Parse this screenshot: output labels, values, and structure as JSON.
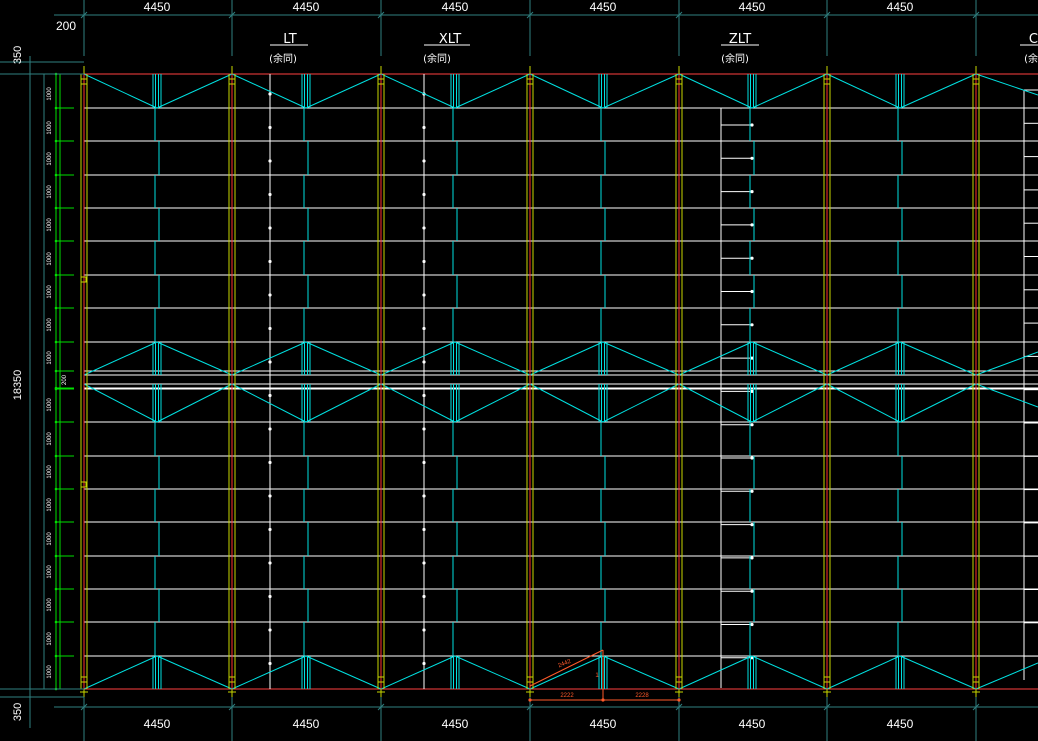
{
  "drawing": {
    "top_dims": [
      "4450",
      "4450",
      "4450",
      "4450",
      "4450",
      "4450"
    ],
    "bottom_dims": [
      "4450",
      "4450",
      "4450",
      "4450",
      "4450",
      "4450"
    ],
    "top_small_dim": "200",
    "left_top_dim": "350",
    "left_bottom_dim": "350",
    "left_total_dim": "18350",
    "left_mid_dim": "200",
    "row_dims_upper": [
      "1000",
      "1000",
      "1000",
      "1000",
      "1000",
      "1000",
      "1000",
      "1000",
      "1000"
    ],
    "row_dims_lower": [
      "1000",
      "1000",
      "1000",
      "1000",
      "1000",
      "1000",
      "1000",
      "1000",
      "1000"
    ],
    "labels": [
      {
        "name": "LT",
        "sub": "(余同)"
      },
      {
        "name": "XLT",
        "sub": "(余同)"
      },
      {
        "name": "ZLT",
        "sub": "(余同)"
      },
      {
        "name": "C",
        "sub": "(余"
      }
    ],
    "red_dims": {
      "diag": "2442",
      "seg1": "2222",
      "seg2": "2228",
      "vert": "1"
    },
    "colors": {
      "background": "#000000",
      "grid": "#ffffff",
      "brace": "#00e0e0",
      "column": "#c8d800",
      "column_red": "#ff3030",
      "axis_red": "#ff4040",
      "dim": "#2f7f7f",
      "green": "#00e000",
      "orange": "#ff5a2a"
    }
  }
}
